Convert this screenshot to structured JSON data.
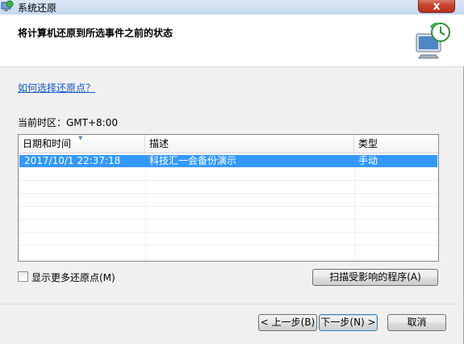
{
  "window": {
    "title": "系统还原",
    "close_glyph": "x"
  },
  "header": {
    "title": "将计算机还原到所选事件之前的状态",
    "icon": "system-restore-icon"
  },
  "help_link": "如何选择还原点？",
  "timezone_label": "当前时区：GMT+8:00",
  "restore_points": {
    "columns": [
      "日期和时间",
      "描述",
      "类型"
    ],
    "rows": [
      {
        "datetime": "2017/10/1 22:37:18",
        "description": "科技汇一会备份演示",
        "type": "手动",
        "selected": true
      }
    ]
  },
  "show_more": {
    "label": "显示更多还原点(M)",
    "checked": false
  },
  "scan_button": "扫描受影响的程序(A)",
  "footer": {
    "back": "< 上一步(B)",
    "next": "下一步(N) >",
    "cancel": "取消"
  },
  "colors": {
    "selection": "#3399ff",
    "link": "#0b57d0",
    "header_bg": "#ffffff",
    "window_bg": "#f0f0f0"
  }
}
